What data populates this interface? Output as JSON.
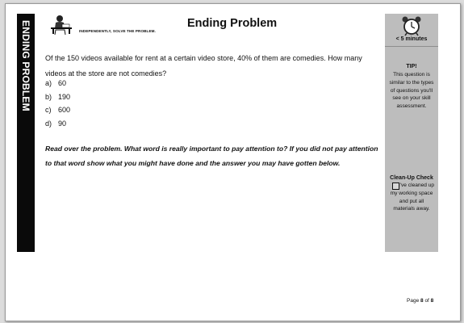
{
  "section_tab": "ENDING PROBLEM",
  "header": {
    "instruction": "INDEPENDENTLY, SOLVE THE PROBLEM.",
    "title": "Ending Problem"
  },
  "question": "Of the 150 videos available for rent at a certain video store, 40% of them are comedies. How many videos at the store are not comedies?",
  "choices": [
    {
      "letter": "a)",
      "text": "60"
    },
    {
      "letter": "b)",
      "text": "190"
    },
    {
      "letter": "c)",
      "text": "600"
    },
    {
      "letter": "d)",
      "text": "90"
    }
  ],
  "reflection": "Read over the problem.  What word is really important to pay attention to?  If you did not pay attention to that word show what you might have done and the answer you may have gotten below.",
  "sidebar": {
    "time_label": "< 5 minutes",
    "tip_heading": "TIP!",
    "tip_text": "This question is similar to the types of questions you'll see on your skill assessment.",
    "cleanup_heading": "Clean-Up Check",
    "cleanup_text": "I've cleaned up my working space and put all materials away."
  },
  "footer": {
    "page_word": "Page",
    "page_current": "8",
    "page_of": "of",
    "page_total": "8"
  },
  "icons": {
    "student": "student-at-desk-icon",
    "timer": "alarm-clock-icon"
  },
  "colors": {
    "side_tab": "#0a0a0a",
    "sidebar": "#bdbdbd"
  }
}
